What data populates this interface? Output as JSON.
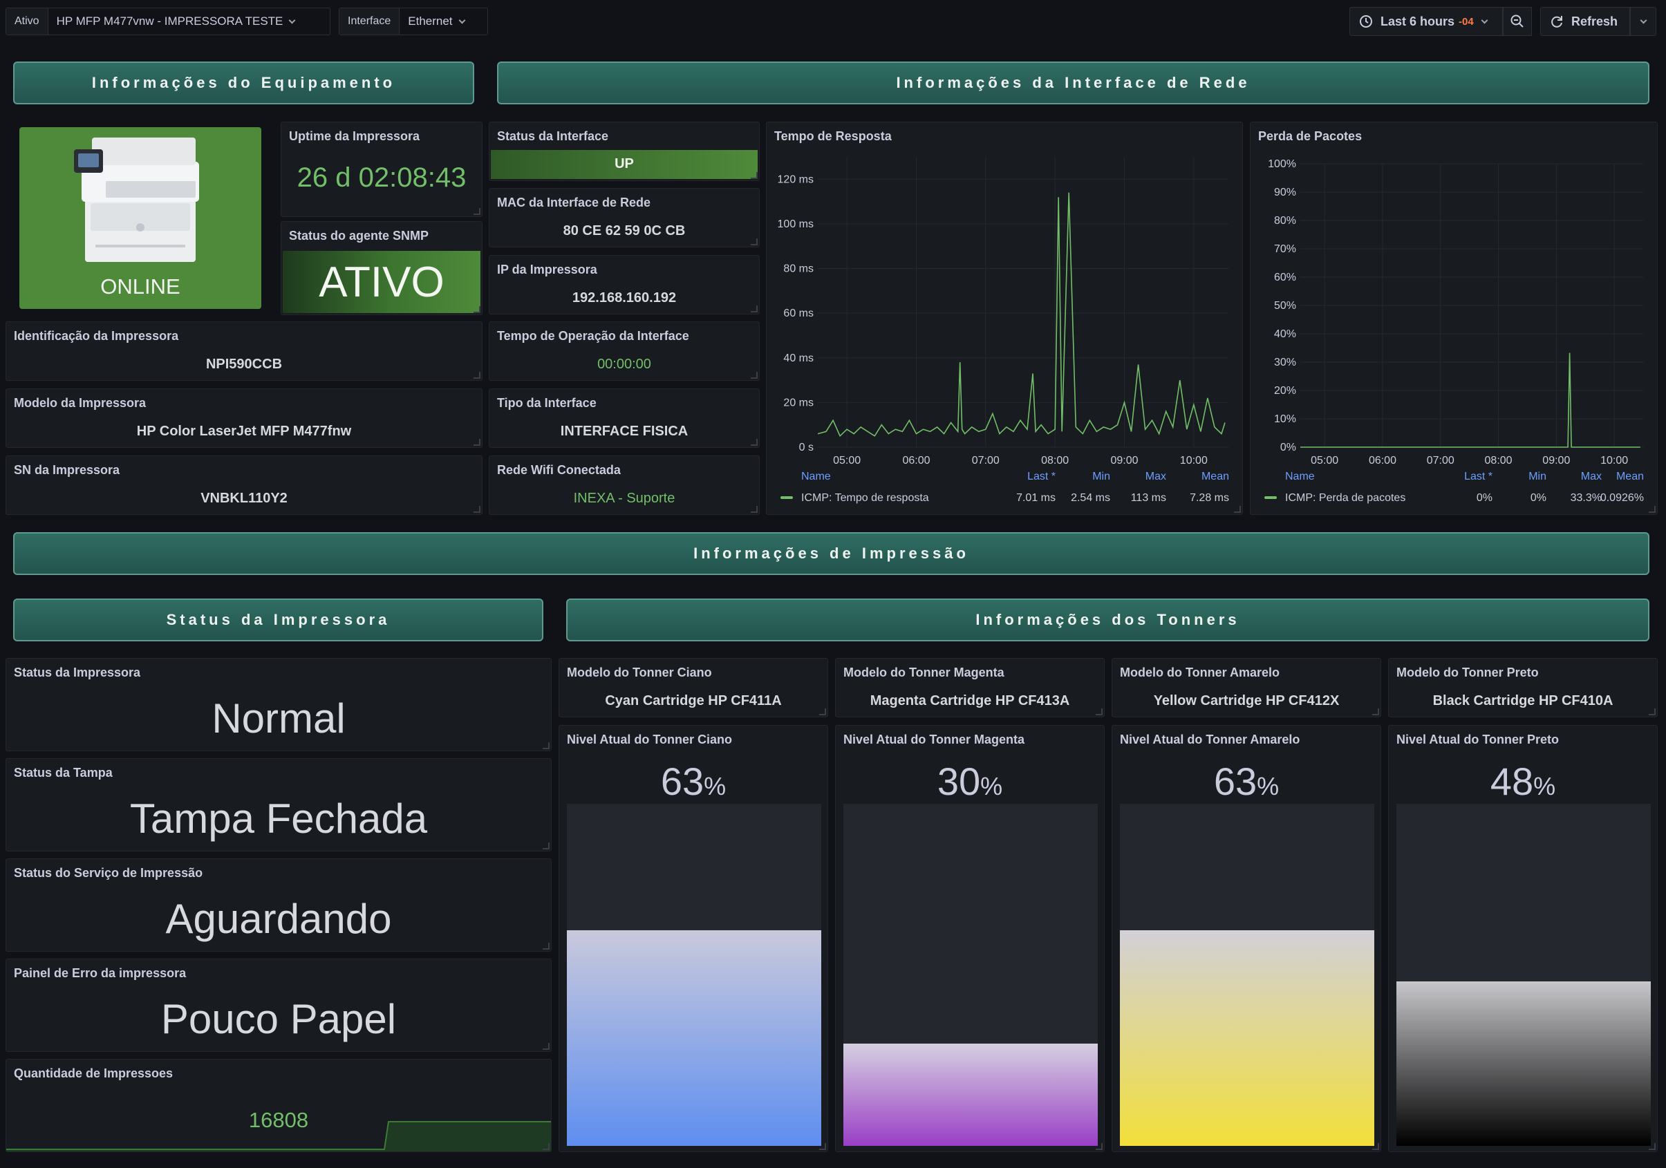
{
  "topbar": {
    "var1_label": "Ativo",
    "var1_value": "HP MFP M477vnw - IMPRESSORA TESTE",
    "var2_label": "Interface",
    "var2_value": "Ethernet",
    "time_range": "Last 6 hours",
    "timezone": "-04",
    "refresh_label": "Refresh"
  },
  "rows": {
    "equip": "Informações do Equipamento",
    "net": "Informações da Interface de Rede",
    "print": "Informações de Impressão",
    "status": "Status da Impressora",
    "toners": "Informações dos Tonners"
  },
  "equipment": {
    "online": "ONLINE",
    "uptime_title": "Uptime da Impressora",
    "uptime_value": "26 d 02:08:43",
    "snmp_title": "Status do agente SNMP",
    "snmp_value": "ATIVO",
    "ident_title": "Identificação da Impressora",
    "ident_value": "NPI590CCB",
    "model_title": "Modelo da Impressora",
    "model_value": "HP Color LaserJet MFP M477fnw",
    "sn_title": "SN da Impressora",
    "sn_value": "VNBKL110Y2"
  },
  "network": {
    "status_title": "Status da Interface",
    "status_value": "UP",
    "mac_title": "MAC da Interface de Rede",
    "mac_value": "80 CE 62 59 0C CB",
    "ip_title": "IP da Impressora",
    "ip_value": "192.168.160.192",
    "op_title": "Tempo de Operação da Interface",
    "op_value": "00:00:00",
    "type_title": "Tipo da Interface",
    "type_value": "INTERFACE FISICA",
    "wifi_title": "Rede Wifi Conectada",
    "wifi_value": "INEXA - Suporte"
  },
  "legend_headers": {
    "name": "Name",
    "last": "Last *",
    "min": "Min",
    "max": "Max",
    "mean": "Mean"
  },
  "chart_data": [
    {
      "type": "line",
      "title": "Tempo de Resposta",
      "x_ticks": [
        "05:00",
        "06:00",
        "07:00",
        "08:00",
        "09:00",
        "10:00"
      ],
      "y_ticks": [
        "0 s",
        "20 ms",
        "40 ms",
        "60 ms",
        "80 ms",
        "100 ms",
        "120 ms"
      ],
      "ylim": [
        0,
        130
      ],
      "xlim_hours": [
        4.58,
        10.5
      ],
      "series": [
        {
          "name": "ICMP: Tempo de resposta",
          "color": "#73bf69",
          "last": "7.01 ms",
          "min": "2.54 ms",
          "max": "113 ms",
          "mean": "7.28 ms",
          "x": [
            4.58,
            4.7,
            4.8,
            4.9,
            5.0,
            5.1,
            5.2,
            5.3,
            5.4,
            5.5,
            5.6,
            5.7,
            5.8,
            5.9,
            6.0,
            6.1,
            6.2,
            6.3,
            6.4,
            6.5,
            6.6,
            6.63,
            6.66,
            6.7,
            6.8,
            6.9,
            7.0,
            7.1,
            7.2,
            7.3,
            7.4,
            7.5,
            7.6,
            7.68,
            7.72,
            7.8,
            7.9,
            8.0,
            8.05,
            8.1,
            8.2,
            8.3,
            8.4,
            8.5,
            8.6,
            8.7,
            8.8,
            8.9,
            9.0,
            9.1,
            9.2,
            9.3,
            9.4,
            9.5,
            9.6,
            9.7,
            9.8,
            9.9,
            10.0,
            10.1,
            10.2,
            10.3,
            10.4,
            10.45
          ],
          "values": [
            6,
            7,
            12,
            5,
            8,
            6,
            9,
            7,
            5,
            10,
            6,
            8,
            7,
            12,
            6,
            8,
            7,
            9,
            6,
            11,
            7,
            38,
            8,
            6,
            9,
            7,
            8,
            15,
            6,
            9,
            7,
            12,
            8,
            33,
            7,
            10,
            6,
            8,
            112,
            7,
            114,
            9,
            6,
            12,
            7,
            9,
            8,
            10,
            20,
            7,
            37,
            8,
            12,
            6,
            16,
            9,
            30,
            8,
            19,
            7,
            22,
            9,
            6,
            11
          ]
        }
      ]
    },
    {
      "type": "line",
      "title": "Perda de Pacotes",
      "x_ticks": [
        "05:00",
        "06:00",
        "07:00",
        "08:00",
        "09:00",
        "10:00"
      ],
      "y_ticks": [
        "0%",
        "10%",
        "20%",
        "30%",
        "40%",
        "50%",
        "60%",
        "70%",
        "80%",
        "90%",
        "100%"
      ],
      "ylim": [
        0,
        100
      ],
      "xlim_hours": [
        4.58,
        10.5
      ],
      "series": [
        {
          "name": "ICMP: Perda de pacotes",
          "color": "#73bf69",
          "last": "0%",
          "min": "0%",
          "max": "33.3%",
          "mean": "0.0926%",
          "x": [
            4.58,
            9.2,
            9.23,
            9.26,
            10.45
          ],
          "values": [
            0,
            0,
            33.3,
            0,
            0
          ]
        }
      ]
    }
  ],
  "status_panels": {
    "printer_title": "Status da Impressora",
    "printer_value": "Normal",
    "lid_title": "Status da Tampa",
    "lid_value": "Tampa Fechada",
    "service_title": "Status do Serviço de Impressão",
    "service_value": "Aguardando",
    "error_title": "Painel de Erro da impressora",
    "error_value": "Pouco Papel",
    "count_title": "Quantidade de Impressoes",
    "count_value": "16808"
  },
  "toners": [
    {
      "model_title": "Modelo do Tonner Ciano",
      "model_value": "Cyan Cartridge HP CF411A",
      "level_title": "Nivel Atual do Tonner Ciano",
      "level": 63,
      "unit": "%",
      "color_top": "#c9c9dc",
      "color_bottom": "#5e8ef0"
    },
    {
      "model_title": "Modelo do Tonner Magenta",
      "model_value": "Magenta Cartridge HP CF413A",
      "level_title": "Nivel Atual do Tonner Magenta",
      "level": 30,
      "unit": "%",
      "color_top": "#d5d0e0",
      "color_bottom": "#9a3fc6"
    },
    {
      "model_title": "Modelo do Tonner Amarelo",
      "model_value": "Yellow Cartridge HP CF412X",
      "level_title": "Nivel Atual do Tonner Amarelo",
      "level": 63,
      "unit": "%",
      "color_top": "#d2d0d8",
      "color_bottom": "#f2df3a"
    },
    {
      "model_title": "Modelo do Tonner Preto",
      "model_value": "Black Cartridge HP CF410A",
      "level_title": "Nivel Atual do Tonner Preto",
      "level": 48,
      "unit": "%",
      "color_top": "#c8c8cc",
      "color_bottom": "#000000"
    }
  ],
  "colors": {
    "green_text": "#73bf69",
    "ok_bg": "#4f8a3a",
    "background": "#111217",
    "panel": "#181b1f"
  }
}
